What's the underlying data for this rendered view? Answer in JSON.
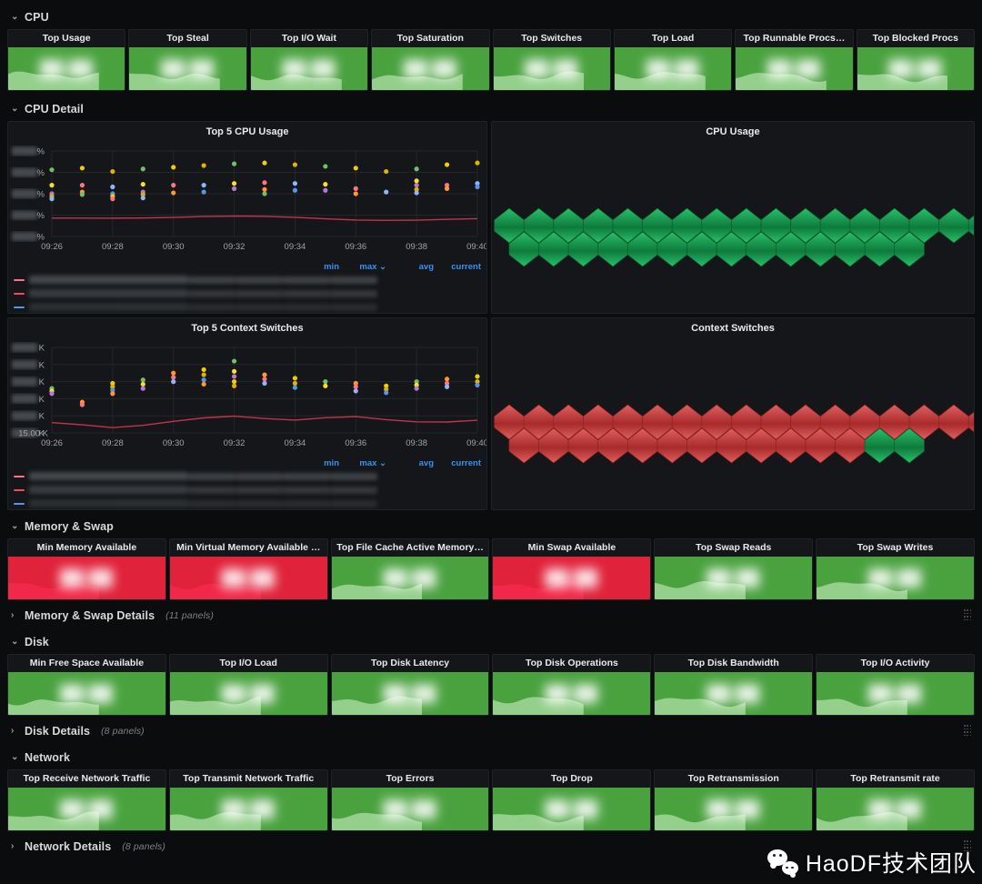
{
  "dashboard": {
    "theme_bg": "#0b0c0e",
    "panel_bg": "#141619",
    "accent_blue": "#3892f3",
    "green": "#56a64b",
    "red": "#e02f44"
  },
  "sections": [
    {
      "id": "cpu",
      "label": "CPU",
      "collapsed": false,
      "chevron": "⌄",
      "panel_count": ""
    },
    {
      "id": "cpu-detail",
      "label": "CPU Detail",
      "collapsed": false,
      "chevron": "⌄",
      "panel_count": ""
    },
    {
      "id": "memory-swap",
      "label": "Memory & Swap",
      "collapsed": false,
      "chevron": "⌄",
      "panel_count": ""
    },
    {
      "id": "memory-swap-details",
      "label": "Memory & Swap Details",
      "collapsed": true,
      "chevron": "›",
      "panel_count": "(11 panels)"
    },
    {
      "id": "disk",
      "label": "Disk",
      "collapsed": false,
      "chevron": "⌄",
      "panel_count": ""
    },
    {
      "id": "disk-details",
      "label": "Disk Details",
      "collapsed": true,
      "chevron": "›",
      "panel_count": "(8 panels)"
    },
    {
      "id": "network",
      "label": "Network",
      "collapsed": false,
      "chevron": "⌄",
      "panel_count": ""
    },
    {
      "id": "network-details",
      "label": "Network Details",
      "collapsed": true,
      "chevron": "›",
      "panel_count": "(8 panels)"
    }
  ],
  "cpu_stats": [
    {
      "title": "Top Usage",
      "color": "#56a64b",
      "value": "",
      "redacted": true
    },
    {
      "title": "Top Steal",
      "color": "#56a64b",
      "value": "",
      "redacted": true
    },
    {
      "title": "Top I/O Wait",
      "color": "#56a64b",
      "value": "",
      "redacted": true
    },
    {
      "title": "Top Saturation",
      "color": "#56a64b",
      "value": "",
      "redacted": true
    },
    {
      "title": "Top Switches",
      "color": "#56a64b",
      "value": "",
      "redacted": true
    },
    {
      "title": "Top Load",
      "color": "#56a64b",
      "value": "",
      "redacted": true
    },
    {
      "title": "Top Runnable Procs…",
      "color": "#56a64b",
      "value": "",
      "redacted": true
    },
    {
      "title": "Top Blocked Procs",
      "color": "#56a64b",
      "value": "",
      "redacted": true
    }
  ],
  "memory_stats": [
    {
      "title": "Min Memory Available",
      "color": "#e02f44",
      "value": "",
      "redacted": true
    },
    {
      "title": "Min Virtual Memory Available …",
      "color": "#e02f44",
      "value": "",
      "redacted": true
    },
    {
      "title": "Top File Cache Active Memory…",
      "color": "#56a64b",
      "value": "",
      "redacted": true
    },
    {
      "title": "Min Swap Available",
      "color": "#e02f44",
      "value": "",
      "redacted": true
    },
    {
      "title": "Top Swap Reads",
      "color": "#56a64b",
      "value": "",
      "redacted": true
    },
    {
      "title": "Top Swap Writes",
      "color": "#56a64b",
      "value": "",
      "redacted": true
    }
  ],
  "disk_stats": [
    {
      "title": "Min Free Space Available",
      "color": "#56a64b",
      "value": "",
      "redacted": true
    },
    {
      "title": "Top I/O Load",
      "color": "#56a64b",
      "value": "",
      "redacted": true
    },
    {
      "title": "Top Disk Latency",
      "color": "#56a64b",
      "value": "",
      "redacted": true
    },
    {
      "title": "Top Disk Operations",
      "color": "#56a64b",
      "value": "",
      "redacted": true
    },
    {
      "title": "Top Disk Bandwidth",
      "color": "#56a64b",
      "value": "",
      "redacted": true
    },
    {
      "title": "Top I/O Activity",
      "color": "#56a64b",
      "value": "",
      "redacted": true
    }
  ],
  "network_stats": [
    {
      "title": "Top Receive Network Traffic",
      "color": "#56a64b",
      "value": "",
      "redacted": true
    },
    {
      "title": "Top Transmit Network Traffic",
      "color": "#56a64b",
      "value": "",
      "redacted": true
    },
    {
      "title": "Top Errors",
      "color": "#56a64b",
      "value": "",
      "redacted": true
    },
    {
      "title": "Top Drop",
      "color": "#56a64b",
      "value": "",
      "redacted": true
    },
    {
      "title": "Top Retransmission",
      "color": "#56a64b",
      "value": "",
      "redacted": true
    },
    {
      "title": "Top Retransmit rate",
      "color": "#56a64b",
      "value": "",
      "redacted": true
    }
  ],
  "legend": {
    "columns": [
      "min",
      "max",
      "avg",
      "current"
    ],
    "sort_column": "max",
    "sort_indicator": "⌄"
  },
  "panels": {
    "top5_cpu_usage": {
      "title": "Top 5 CPU Usage"
    },
    "cpu_usage_hex": {
      "title": "CPU Usage"
    },
    "top5_context_switches": {
      "title": "Top 5 Context Switches"
    },
    "context_switches_hex": {
      "title": "Context Switches"
    }
  },
  "watermark": {
    "text": "HaoDF技术团队",
    "icon": "wechat-icon"
  },
  "chart_data": [
    {
      "id": "top5_cpu_usage",
      "type": "scatter",
      "title": "Top 5 CPU Usage",
      "xlabel": "",
      "ylabel": "",
      "grid": true,
      "legend_position": "bottom-table",
      "x_ticks": [
        "09:26",
        "09:28",
        "09:30",
        "09:32",
        "09:34",
        "09:36",
        "09:38",
        "09:40"
      ],
      "y_ticks": [
        "%",
        "%",
        "%",
        "%",
        "%"
      ],
      "y_ticks_redacted": true,
      "series_colors": [
        "#73bf69",
        "#5794f2",
        "#fade2a",
        "#f2cc0c",
        "#b877d9",
        "#ff7383",
        "#e0b400",
        "#ff9830",
        "#8ab8ff"
      ],
      "points": [
        {
          "x": "09:26",
          "vals": [
            0.78,
            0.6,
            0.5,
            0.47,
            0.44
          ]
        },
        {
          "x": "09:27",
          "vals": [
            0.8,
            0.6,
            0.52,
            0.49
          ]
        },
        {
          "x": "09:28",
          "vals": [
            0.76,
            0.58,
            0.5,
            0.47,
            0.44
          ]
        },
        {
          "x": "09:29",
          "vals": [
            0.79,
            0.61,
            0.52,
            0.49,
            0.45
          ]
        },
        {
          "x": "09:30",
          "vals": [
            0.81,
            0.6,
            0.51
          ]
        },
        {
          "x": "09:31",
          "vals": [
            0.83,
            0.6,
            0.52
          ]
        },
        {
          "x": "09:32",
          "vals": [
            0.85,
            0.62,
            0.56
          ]
        },
        {
          "x": "09:33",
          "vals": [
            0.86,
            0.63,
            0.55,
            0.5
          ]
        },
        {
          "x": "09:34",
          "vals": [
            0.84,
            0.62,
            0.54
          ]
        },
        {
          "x": "09:35",
          "vals": [
            0.82,
            0.61,
            0.54
          ]
        },
        {
          "x": "09:36",
          "vals": [
            0.8,
            0.56,
            0.5
          ]
        },
        {
          "x": "09:37",
          "vals": [
            0.76,
            0.52
          ]
        },
        {
          "x": "09:38",
          "vals": [
            0.79,
            0.65,
            0.6,
            0.55,
            0.51
          ]
        },
        {
          "x": "09:39",
          "vals": [
            0.84,
            0.6,
            0.56
          ]
        },
        {
          "x": "09:40",
          "vals": [
            0.86,
            0.62,
            0.58
          ]
        }
      ],
      "trend_line": {
        "name": "trend",
        "color": "#c4334b",
        "values": [
          0.215,
          0.215,
          0.214,
          0.216,
          0.222,
          0.233,
          0.238,
          0.235,
          0.224,
          0.206,
          0.193,
          0.188,
          0.19,
          0.2,
          0.208
        ]
      }
    },
    {
      "id": "cpu_usage_hex",
      "type": "heatmap",
      "title": "CPU Usage",
      "shape": "hexagon",
      "rows": [
        {
          "count": 17,
          "states": [
            "ok",
            "ok",
            "ok",
            "ok",
            "ok",
            "ok",
            "ok",
            "ok",
            "ok",
            "ok",
            "ok",
            "ok",
            "ok",
            "ok",
            "ok",
            "ok",
            "ok"
          ]
        },
        {
          "count": 14,
          "states": [
            "ok",
            "ok",
            "ok",
            "ok",
            "ok",
            "ok",
            "ok",
            "ok",
            "ok",
            "ok",
            "ok",
            "ok",
            "ok",
            "ok"
          ]
        }
      ],
      "state_colors": {
        "ok": "#1f9d55",
        "alert": "#d44a4a"
      }
    },
    {
      "id": "top5_context_switches",
      "type": "scatter",
      "title": "Top 5 Context Switches",
      "xlabel": "",
      "ylabel": "",
      "grid": true,
      "legend_position": "bottom-table",
      "x_ticks": [
        "09:26",
        "09:28",
        "09:30",
        "09:32",
        "09:34",
        "09:36",
        "09:38",
        "09:40"
      ],
      "y_ticks": [
        "2  K",
        "1  K",
        "1  K",
        "1  K",
        "1  K",
        "15.00 K"
      ],
      "y_ticks_redacted": true,
      "y_tick_last": "15.00 K",
      "series_colors": [
        "#73bf69",
        "#5794f2",
        "#fade2a",
        "#ff9830",
        "#b877d9",
        "#ff7383",
        "#f2cc0c",
        "#8ab8ff",
        "#e0b400"
      ],
      "points": [
        {
          "x": "09:26",
          "vals": [
            0.52,
            0.49,
            0.46
          ]
        },
        {
          "x": "09:27",
          "vals": [
            0.36,
            0.33
          ]
        },
        {
          "x": "09:28",
          "vals": [
            0.58,
            0.54,
            0.5,
            0.46
          ]
        },
        {
          "x": "09:29",
          "vals": [
            0.62,
            0.57,
            0.52
          ]
        },
        {
          "x": "09:30",
          "vals": [
            0.7,
            0.65,
            0.6
          ]
        },
        {
          "x": "09:31",
          "vals": [
            0.74,
            0.68,
            0.62,
            0.57
          ]
        },
        {
          "x": "09:32",
          "vals": [
            0.84,
            0.72,
            0.66,
            0.6,
            0.55
          ]
        },
        {
          "x": "09:33",
          "vals": [
            0.68,
            0.63,
            0.58
          ]
        },
        {
          "x": "09:34",
          "vals": [
            0.64,
            0.58,
            0.53
          ]
        },
        {
          "x": "09:35",
          "vals": [
            0.6,
            0.55
          ]
        },
        {
          "x": "09:36",
          "vals": [
            0.58,
            0.54,
            0.49
          ]
        },
        {
          "x": "09:37",
          "vals": [
            0.55,
            0.51,
            0.47
          ]
        },
        {
          "x": "09:38",
          "vals": [
            0.6,
            0.56,
            0.52
          ]
        },
        {
          "x": "09:39",
          "vals": [
            0.63,
            0.58,
            0.54
          ]
        },
        {
          "x": "09:40",
          "vals": [
            0.66,
            0.6,
            0.56
          ]
        }
      ],
      "trend_line": {
        "name": "trend",
        "color": "#c4334b",
        "values": [
          0.12,
          0.095,
          0.062,
          0.088,
          0.135,
          0.175,
          0.196,
          0.168,
          0.15,
          0.178,
          0.19,
          0.155,
          0.13,
          0.128,
          0.148
        ]
      }
    },
    {
      "id": "context_switches_hex",
      "type": "heatmap",
      "title": "Context Switches",
      "shape": "hexagon",
      "rows": [
        {
          "count": 17,
          "states": [
            "alert",
            "alert",
            "alert",
            "alert",
            "alert",
            "alert",
            "alert",
            "alert",
            "alert",
            "alert",
            "alert",
            "alert",
            "alert",
            "alert",
            "alert",
            "alert",
            "alert"
          ]
        },
        {
          "count": 14,
          "states": [
            "alert",
            "alert",
            "alert",
            "alert",
            "alert",
            "alert",
            "alert",
            "alert",
            "alert",
            "alert",
            "alert",
            "alert",
            "ok",
            "ok"
          ]
        }
      ],
      "state_colors": {
        "ok": "#1f9d55",
        "alert": "#d44a4a"
      }
    }
  ]
}
